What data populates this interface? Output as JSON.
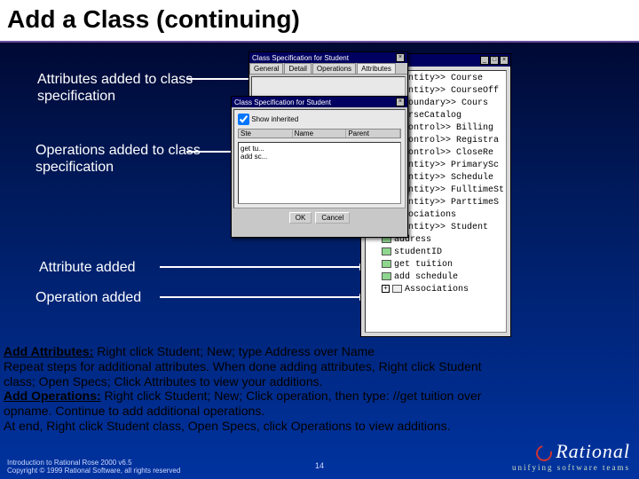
{
  "title": "Add a Class (continuing)",
  "callouts": {
    "attributes": "Attributes added to class specification",
    "operations": "Operations added to class specification",
    "attribute_single": "Attribute added",
    "operation_single": "Operation added"
  },
  "browser": {
    "items": [
      "<<entity>> Course",
      "<<entity>> CourseOff",
      "<<boundary>> Cours",
      "CourseCatalog",
      "<<control>> Billing",
      "<<control>> Registra",
      "<<control>> CloseRe",
      "<<entity>> PrimarySc",
      "<<entity>> Schedule",
      "<<entity>> FulltimeSt",
      "<<entity>> ParttimeS",
      "Associations"
    ],
    "selected": "<<entity>> Student",
    "sub": [
      "address",
      "studentID",
      "get tuition",
      "add schedule",
      "Associations"
    ]
  },
  "spec1": {
    "title": "Class Specification for Student",
    "tabs": [
      "General",
      "Detail",
      "Operations",
      "Attributes"
    ],
    "ok": "OK",
    "cancel": "Cancel"
  },
  "spec2": {
    "title": "Class Specification for Student",
    "check": "Show inherited",
    "headers": [
      "Ste",
      "Name",
      "Parent"
    ],
    "rows": [
      "get tu...",
      "add sc..."
    ],
    "ok": "OK",
    "cancel": "Cancel"
  },
  "instructions": {
    "l1a": "Add Attributes:",
    "l1b": "  Right click Student;  New;  type Address over Name",
    "l2": " Repeat steps for additional attributes.  When done adding attributes, Right click Student",
    "l3": " class;  Open Specs;  Click Attributes to view your additions.",
    "l4a": "Add Operations:",
    "l4b": "  Right click Student; New; Click operation, then type: //get tuition over",
    "l5": " opname.  Continue to add additional operations.",
    "l6": "At end, Right click Student class, Open Specs, click Operations to view additions."
  },
  "footer": {
    "l1": "Introduction to Rational Rose 2000 v6.5",
    "l2": "Copyright © 1999 Rational Software, all rights reserved",
    "page": "14",
    "brand": "Rational",
    "tag": "unifying software teams"
  }
}
